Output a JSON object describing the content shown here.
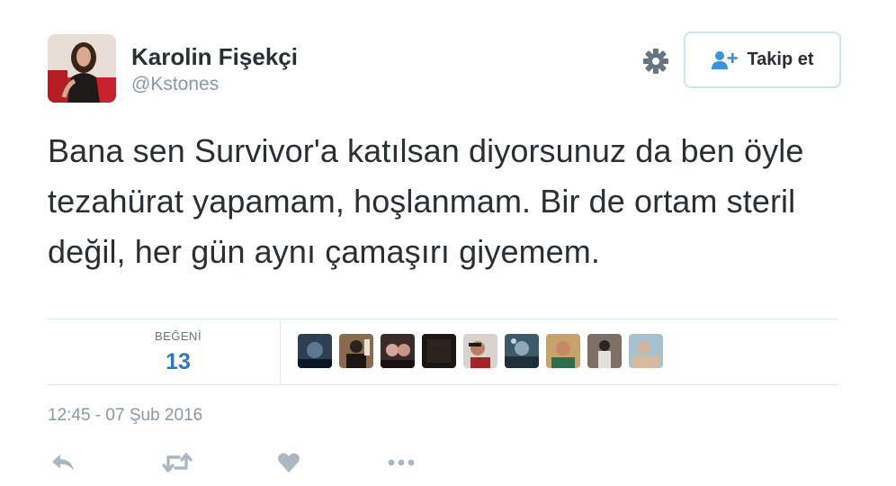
{
  "user": {
    "name": "Karolin Fişekçi",
    "handle": "@Kstones"
  },
  "follow_button": {
    "label": "Takip et"
  },
  "tweet": {
    "text": "Bana sen Survivor'a katılsan diyorsunuz da ben öyle tezahürat yapamam, hoşlanmam. Bir de ortam steril değil, her gün aynı çamaşırı giyemem."
  },
  "stats": {
    "likes_label": "BEĞENİ",
    "likes_count": "13"
  },
  "timestamp": "12:45 - 07 Şub 2016",
  "colors": {
    "accent": "#2b7bb9",
    "follow_icon": "#3b94d9",
    "muted": "#8899a6",
    "border": "#e1e8ed"
  },
  "icons": {
    "settings": "gear-icon",
    "follow": "add-person-icon",
    "reply": "reply-arrow-icon",
    "retweet": "retweet-icon",
    "like": "heart-icon",
    "more": "ellipsis-icon"
  }
}
